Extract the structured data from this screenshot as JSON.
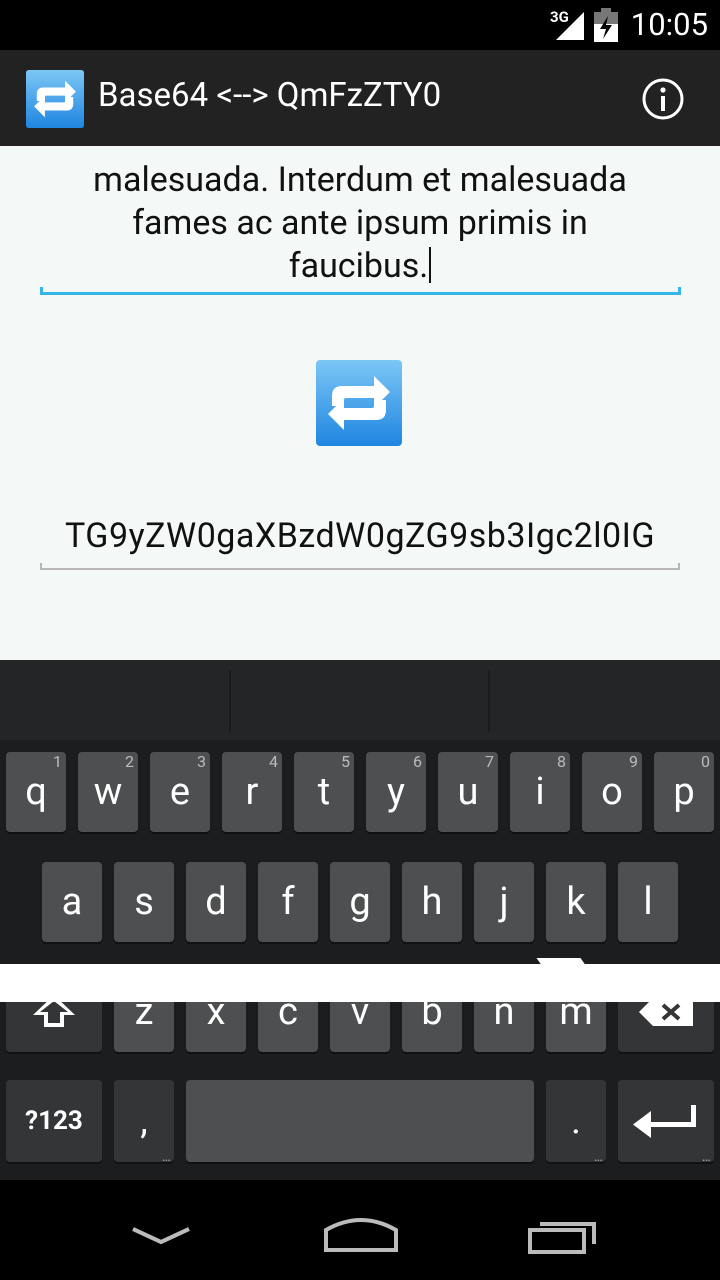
{
  "status_bar": {
    "network": "3G",
    "time": "10:05"
  },
  "action_bar": {
    "title": "Base64 <--> QmFzZTY0",
    "icon": "repeat-arrows-icon",
    "info_icon": "info-icon"
  },
  "main": {
    "input_lines": [
      "malesuada. Interdum et malesuada",
      "fames ac ante ipsum primis in",
      "faucibus."
    ],
    "convert_icon": "repeat-arrows-icon",
    "output_value": "TG9yZW0gaXBzdW0gZG9sb3Igc2l0IG"
  },
  "keyboard": {
    "row1": [
      {
        "label": "q",
        "hint": "1"
      },
      {
        "label": "w",
        "hint": "2"
      },
      {
        "label": "e",
        "hint": "3"
      },
      {
        "label": "r",
        "hint": "4"
      },
      {
        "label": "t",
        "hint": "5"
      },
      {
        "label": "y",
        "hint": "6"
      },
      {
        "label": "u",
        "hint": "7"
      },
      {
        "label": "i",
        "hint": "8"
      },
      {
        "label": "o",
        "hint": "9"
      },
      {
        "label": "p",
        "hint": "0"
      }
    ],
    "row2": [
      "a",
      "s",
      "d",
      "f",
      "g",
      "h",
      "j",
      "k",
      "l"
    ],
    "row3": [
      "z",
      "x",
      "c",
      "v",
      "b",
      "n",
      "m"
    ],
    "symbols_label": "?123",
    "comma_label": ",",
    "period_label": ".",
    "shift_icon": "shift-icon",
    "delete_icon": "backspace-icon",
    "enter_icon": "enter-icon"
  },
  "nav_bar": {
    "back_icon": "back-chevron-icon",
    "home_icon": "home-icon",
    "recents_icon": "recents-icon"
  }
}
